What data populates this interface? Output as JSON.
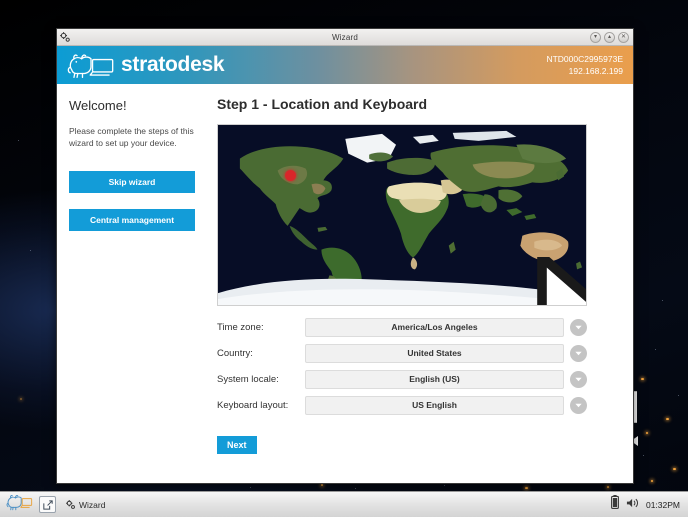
{
  "desktop": {
    "wallpaper_name": "earth-from-space-wallpaper"
  },
  "window": {
    "titlebar": {
      "title": "Wizard",
      "config_icon": "gear-icon",
      "minimize_label": "▾",
      "maximize_label": "▴",
      "close_label": "✕"
    },
    "brandbar": {
      "logo_icon": "stratodesk-bear-logo",
      "brand": "stratodesk",
      "device_id": "NTD000C2995973E",
      "ip_address": "192.168.2.199",
      "gradient_start": "#0c9cd4",
      "gradient_end": "#ea9e4c"
    },
    "sidebar": {
      "title": "Welcome!",
      "description": "Please complete the steps of this wizard to set up your device.",
      "buttons": [
        {
          "label": "Skip wizard",
          "name": "skip-wizard-button"
        },
        {
          "label": "Central management",
          "name": "central-management-button"
        }
      ],
      "accent_color": "#139cd8"
    },
    "main": {
      "step_title": "Step 1 - Location and Keyboard",
      "map": {
        "name": "world-map",
        "marker_label": "selected-location-marker",
        "marker_color": "#d9262a",
        "cursor": "mouse-pointer"
      },
      "fields": [
        {
          "label": "Time zone:",
          "value": "America/Los Angeles",
          "name": "time-zone"
        },
        {
          "label": "Country:",
          "value": "United States",
          "name": "country"
        },
        {
          "label": "System locale:",
          "value": "English (US)",
          "name": "system-locale"
        },
        {
          "label": "Keyboard layout:",
          "value": "US English",
          "name": "keyboard-layout"
        }
      ],
      "next_label": "Next"
    }
  },
  "taskbar": {
    "logo_icon": "stratodesk-bear-logo",
    "launcher_icon": "launch-app-icon",
    "task": {
      "icon": "gear-icon",
      "label": "Wizard"
    },
    "battery_icon": "battery-icon",
    "volume_icon": "volume-icon",
    "clock": "01:32PM"
  }
}
